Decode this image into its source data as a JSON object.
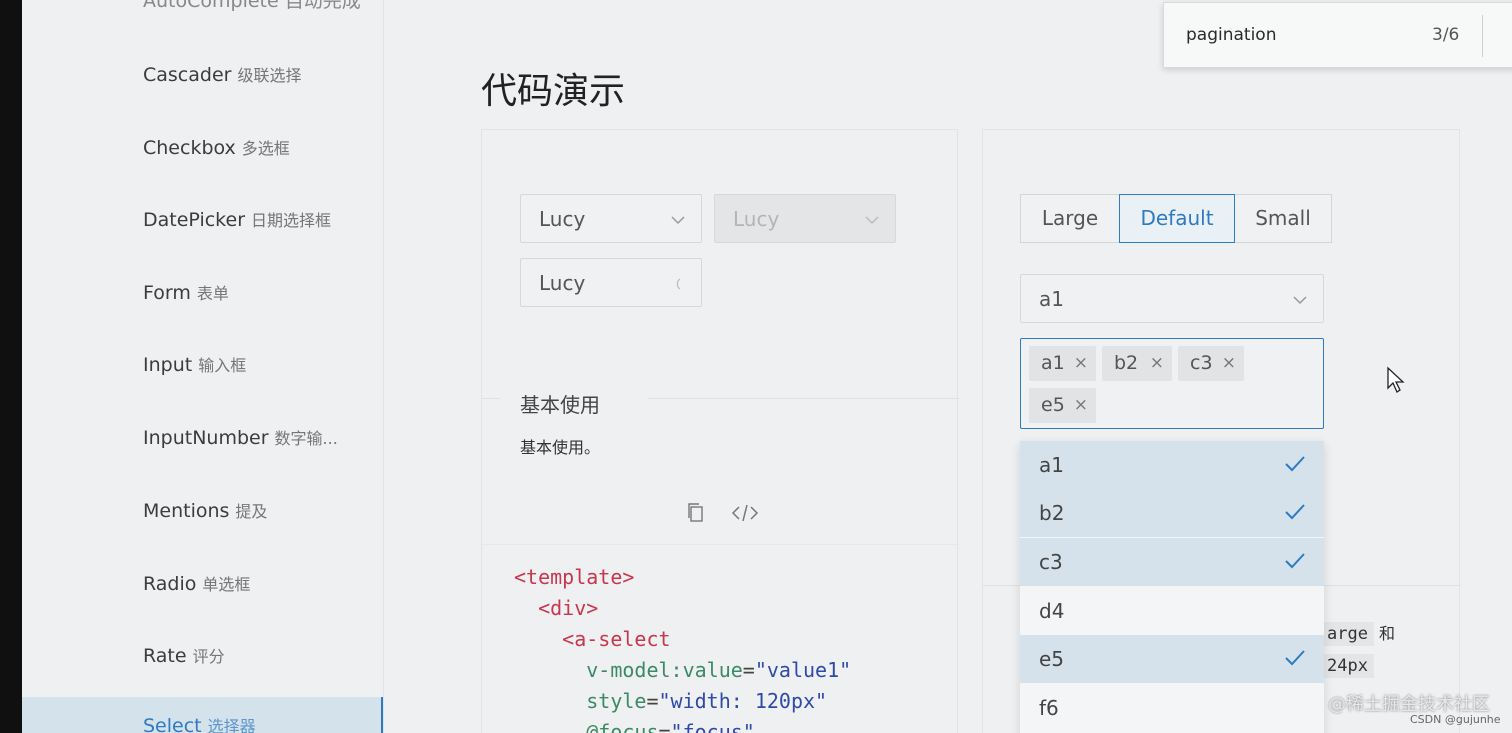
{
  "sidebar": {
    "top_cut": "AutoComplete 自动完成",
    "items": [
      {
        "en": "Cascader",
        "cn": "级联选择"
      },
      {
        "en": "Checkbox",
        "cn": "多选框"
      },
      {
        "en": "DatePicker",
        "cn": "日期选择框"
      },
      {
        "en": "Form",
        "cn": "表单"
      },
      {
        "en": "Input",
        "cn": "输入框"
      },
      {
        "en": "InputNumber",
        "cn": "数字输..."
      },
      {
        "en": "Mentions",
        "cn": "提及"
      },
      {
        "en": "Radio",
        "cn": "单选框"
      },
      {
        "en": "Rate",
        "cn": "评分"
      }
    ],
    "selected": {
      "en": "Select",
      "cn": "选择器"
    }
  },
  "page_title": "代码演示",
  "search": {
    "text": "pagination",
    "count": "3/6"
  },
  "left_demo": {
    "select1": "Lucy",
    "select2_disabled": "Lucy",
    "select3": "Lucy",
    "section_title": "基本使用",
    "description": "基本使用。",
    "code": {
      "l1_open": "<",
      "l1_tag": "template",
      "l1_close": ">",
      "l2_open": "<",
      "l2_tag": "div",
      "l2_close": ">",
      "l3_open": "<",
      "l3_tag": "a-select",
      "l4_attr": "v-model:value",
      "l4_eq": "=",
      "l4_str": "\"value1\"",
      "l5_attr": "style",
      "l5_eq": "=",
      "l5_str": "\"width: 120px\"",
      "l6_attr": "@focus",
      "l6_eq": "=",
      "l6_str": "\"focus\""
    }
  },
  "right_demo": {
    "sizes": [
      "Large",
      "Default",
      "Small"
    ],
    "active_size": "Default",
    "single_select": "a1",
    "tags": [
      "a1",
      "b2",
      "c3",
      "e5"
    ],
    "tag_close": "×",
    "options": [
      {
        "label": "a1",
        "selected": true
      },
      {
        "label": "b2",
        "selected": true
      },
      {
        "label": "c3",
        "selected": true
      },
      {
        "label": "d4",
        "selected": false
      },
      {
        "label": "e5",
        "selected": true
      },
      {
        "label": "f6",
        "selected": false
      }
    ],
    "desc_frag1": "arge",
    "desc_frag2": "和",
    "desc_frag3": "24px"
  },
  "watermark": {
    "text": "@稀土掘金技术社区",
    "sub": "CSDN @gujunhe"
  },
  "colors": {
    "accent": "#2f7ac0",
    "selected_bg": "#d5e2ec"
  }
}
